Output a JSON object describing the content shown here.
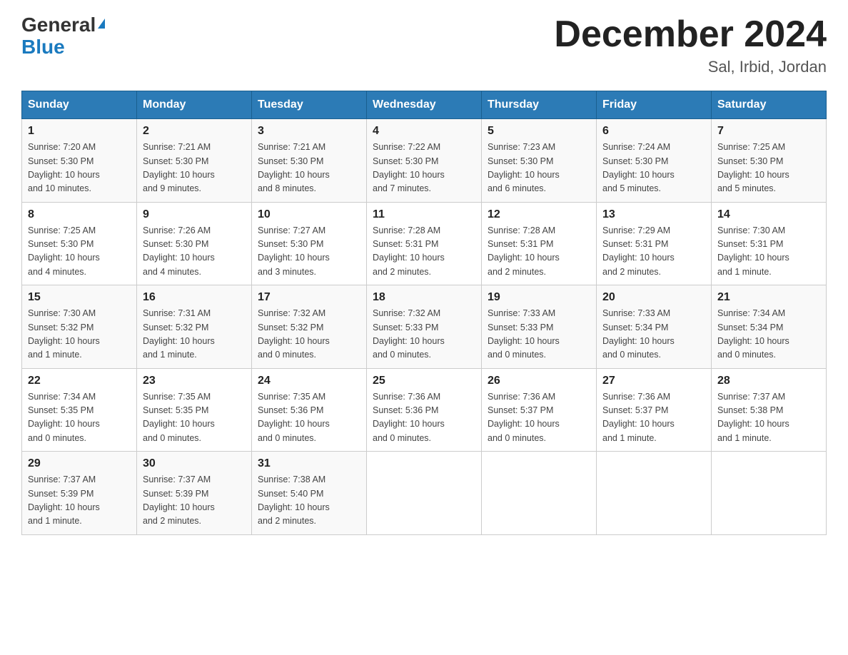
{
  "header": {
    "logo_general": "General",
    "logo_blue": "Blue",
    "month_title": "December 2024",
    "location": "Sal, Irbid, Jordan"
  },
  "weekdays": [
    "Sunday",
    "Monday",
    "Tuesday",
    "Wednesday",
    "Thursday",
    "Friday",
    "Saturday"
  ],
  "weeks": [
    [
      {
        "day": "1",
        "sunrise": "7:20 AM",
        "sunset": "5:30 PM",
        "daylight": "10 hours and 10 minutes."
      },
      {
        "day": "2",
        "sunrise": "7:21 AM",
        "sunset": "5:30 PM",
        "daylight": "10 hours and 9 minutes."
      },
      {
        "day": "3",
        "sunrise": "7:21 AM",
        "sunset": "5:30 PM",
        "daylight": "10 hours and 8 minutes."
      },
      {
        "day": "4",
        "sunrise": "7:22 AM",
        "sunset": "5:30 PM",
        "daylight": "10 hours and 7 minutes."
      },
      {
        "day": "5",
        "sunrise": "7:23 AM",
        "sunset": "5:30 PM",
        "daylight": "10 hours and 6 minutes."
      },
      {
        "day": "6",
        "sunrise": "7:24 AM",
        "sunset": "5:30 PM",
        "daylight": "10 hours and 5 minutes."
      },
      {
        "day": "7",
        "sunrise": "7:25 AM",
        "sunset": "5:30 PM",
        "daylight": "10 hours and 5 minutes."
      }
    ],
    [
      {
        "day": "8",
        "sunrise": "7:25 AM",
        "sunset": "5:30 PM",
        "daylight": "10 hours and 4 minutes."
      },
      {
        "day": "9",
        "sunrise": "7:26 AM",
        "sunset": "5:30 PM",
        "daylight": "10 hours and 4 minutes."
      },
      {
        "day": "10",
        "sunrise": "7:27 AM",
        "sunset": "5:30 PM",
        "daylight": "10 hours and 3 minutes."
      },
      {
        "day": "11",
        "sunrise": "7:28 AM",
        "sunset": "5:31 PM",
        "daylight": "10 hours and 2 minutes."
      },
      {
        "day": "12",
        "sunrise": "7:28 AM",
        "sunset": "5:31 PM",
        "daylight": "10 hours and 2 minutes."
      },
      {
        "day": "13",
        "sunrise": "7:29 AM",
        "sunset": "5:31 PM",
        "daylight": "10 hours and 2 minutes."
      },
      {
        "day": "14",
        "sunrise": "7:30 AM",
        "sunset": "5:31 PM",
        "daylight": "10 hours and 1 minute."
      }
    ],
    [
      {
        "day": "15",
        "sunrise": "7:30 AM",
        "sunset": "5:32 PM",
        "daylight": "10 hours and 1 minute."
      },
      {
        "day": "16",
        "sunrise": "7:31 AM",
        "sunset": "5:32 PM",
        "daylight": "10 hours and 1 minute."
      },
      {
        "day": "17",
        "sunrise": "7:32 AM",
        "sunset": "5:32 PM",
        "daylight": "10 hours and 0 minutes."
      },
      {
        "day": "18",
        "sunrise": "7:32 AM",
        "sunset": "5:33 PM",
        "daylight": "10 hours and 0 minutes."
      },
      {
        "day": "19",
        "sunrise": "7:33 AM",
        "sunset": "5:33 PM",
        "daylight": "10 hours and 0 minutes."
      },
      {
        "day": "20",
        "sunrise": "7:33 AM",
        "sunset": "5:34 PM",
        "daylight": "10 hours and 0 minutes."
      },
      {
        "day": "21",
        "sunrise": "7:34 AM",
        "sunset": "5:34 PM",
        "daylight": "10 hours and 0 minutes."
      }
    ],
    [
      {
        "day": "22",
        "sunrise": "7:34 AM",
        "sunset": "5:35 PM",
        "daylight": "10 hours and 0 minutes."
      },
      {
        "day": "23",
        "sunrise": "7:35 AM",
        "sunset": "5:35 PM",
        "daylight": "10 hours and 0 minutes."
      },
      {
        "day": "24",
        "sunrise": "7:35 AM",
        "sunset": "5:36 PM",
        "daylight": "10 hours and 0 minutes."
      },
      {
        "day": "25",
        "sunrise": "7:36 AM",
        "sunset": "5:36 PM",
        "daylight": "10 hours and 0 minutes."
      },
      {
        "day": "26",
        "sunrise": "7:36 AM",
        "sunset": "5:37 PM",
        "daylight": "10 hours and 0 minutes."
      },
      {
        "day": "27",
        "sunrise": "7:36 AM",
        "sunset": "5:37 PM",
        "daylight": "10 hours and 1 minute."
      },
      {
        "day": "28",
        "sunrise": "7:37 AM",
        "sunset": "5:38 PM",
        "daylight": "10 hours and 1 minute."
      }
    ],
    [
      {
        "day": "29",
        "sunrise": "7:37 AM",
        "sunset": "5:39 PM",
        "daylight": "10 hours and 1 minute."
      },
      {
        "day": "30",
        "sunrise": "7:37 AM",
        "sunset": "5:39 PM",
        "daylight": "10 hours and 2 minutes."
      },
      {
        "day": "31",
        "sunrise": "7:38 AM",
        "sunset": "5:40 PM",
        "daylight": "10 hours and 2 minutes."
      },
      null,
      null,
      null,
      null
    ]
  ],
  "labels": {
    "sunrise": "Sunrise:",
    "sunset": "Sunset:",
    "daylight": "Daylight:"
  }
}
